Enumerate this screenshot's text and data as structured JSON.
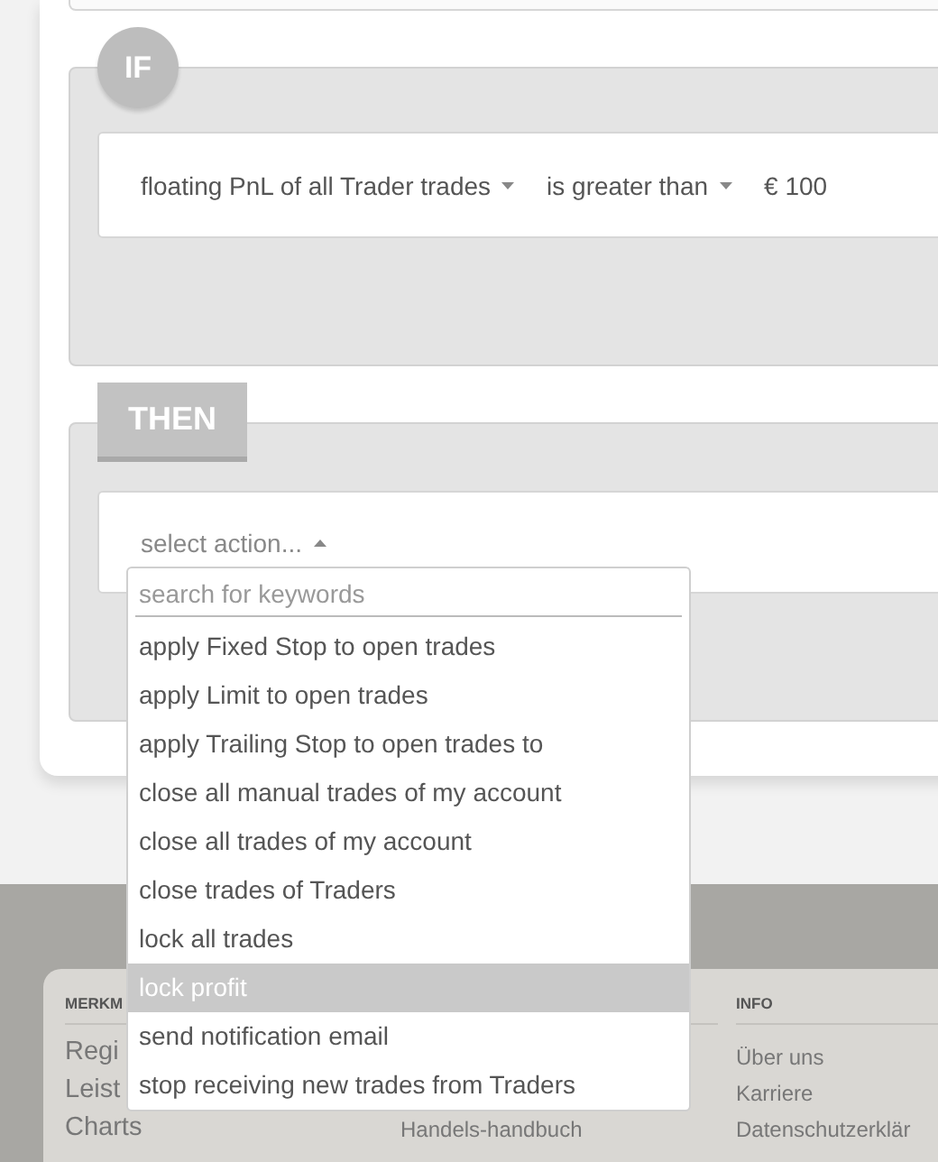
{
  "condition": {
    "label": "IF",
    "fields": [
      {
        "kind": "dropdown",
        "text": "floating PnL of all Trader trades"
      },
      {
        "kind": "dropdown",
        "text": "is greater than"
      },
      {
        "kind": "value",
        "text": "€ 100"
      }
    ]
  },
  "action": {
    "label": "THEN",
    "select": {
      "text": "select action...",
      "expanded": true
    },
    "search_placeholder": "search for keywords",
    "options": [
      {
        "label": "apply Fixed Stop to open trades",
        "selected": false
      },
      {
        "label": "apply Limit to open trades",
        "selected": false
      },
      {
        "label": "apply Trailing Stop to open trades to",
        "selected": false
      },
      {
        "label": "close all manual trades of my account",
        "selected": false
      },
      {
        "label": "close all trades of my account",
        "selected": false
      },
      {
        "label": "close trades of Traders",
        "selected": false
      },
      {
        "label": "lock all trades",
        "selected": false
      },
      {
        "label": "lock profit",
        "selected": true
      },
      {
        "label": "send notification email",
        "selected": false
      },
      {
        "label": "stop receiving new trades from Traders",
        "selected": false
      }
    ]
  },
  "footer": {
    "columns": [
      {
        "kind": "large",
        "heading": "MERKM",
        "links": [
          "Regi",
          "Leist",
          "Charts"
        ]
      },
      {
        "kind": "small",
        "links": [
          "Handels-handbuch"
        ]
      },
      {
        "kind": "small",
        "heading": "INFO",
        "links": [
          "Über uns",
          "Karriere",
          "Datenschutzerklär"
        ]
      }
    ]
  }
}
